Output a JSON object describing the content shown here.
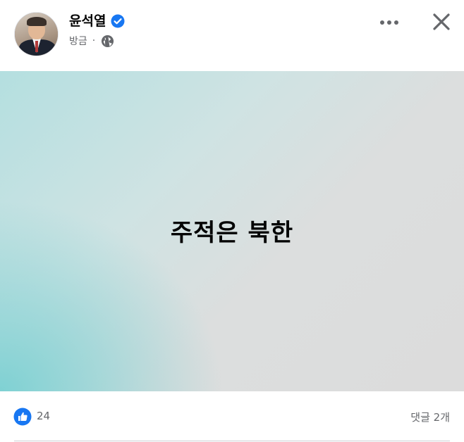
{
  "post": {
    "author": {
      "name": "윤석열",
      "verified": true
    },
    "timestamp": "방금",
    "separator": "·",
    "privacy_icon": "globe-icon",
    "content_text": "주적은 북한",
    "background_colors": {
      "teal": "#7fd1d3",
      "gray": "#dcdcdc"
    }
  },
  "header_actions": {
    "more_icon": "more-horizontal-icon",
    "close_icon": "close-icon"
  },
  "reactions": {
    "like_icon": "like-icon",
    "count": "24",
    "accent": "#1877f2"
  },
  "comments": {
    "label": "댓글 2개"
  }
}
